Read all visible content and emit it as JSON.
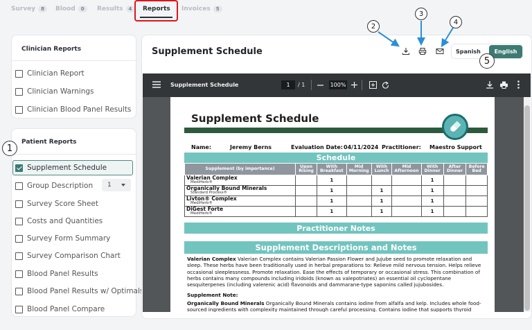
{
  "tabs": [
    {
      "label": "Survey",
      "count": "8"
    },
    {
      "label": "Blood",
      "count": "0"
    },
    {
      "label": "Results",
      "count": "4"
    },
    {
      "label": "Reports"
    },
    {
      "label": "Invoices",
      "count": "5"
    }
  ],
  "clinician": {
    "title": "Clinician Reports",
    "items": [
      "Clinician Report",
      "Clinician Warnings",
      "Clinician Blood Panel Results"
    ]
  },
  "patient": {
    "title": "Patient Reports",
    "items": [
      "Supplement Schedule",
      "Group Description",
      "Survey Score Sheet",
      "Costs and Quantities",
      "Survey Form Summary",
      "Survey Comparison Chart",
      "Blood Panel Results",
      "Blood Panel Results w/ Optimals",
      "Blood Panel Compare"
    ],
    "group_select_value": "1"
  },
  "callouts": [
    "1",
    "2",
    "3",
    "4",
    "5"
  ],
  "document": {
    "title": "Supplement Schedule",
    "lang_spanish": "Spanish",
    "lang_english": "English"
  },
  "viewer": {
    "filename": "Supplement Schedule",
    "page_current": "1",
    "page_total": "/ 1",
    "zoom": "100%"
  },
  "pdf": {
    "title": "Supplement Schedule",
    "name_label": "Name:",
    "name_value": "Jeremy Berns",
    "date_label": "Evaluation Date:",
    "date_value": "04/11/2024",
    "practitioner_label": "Practitioner:",
    "practitioner_value": "Maestro Support",
    "schedule_heading": "Schedule",
    "columns": [
      "Supplement (by importance)",
      "Upon Rising",
      "With Breakfast",
      "Mid Morning",
      "With Lunch",
      "Mid Afternoon",
      "With Dinner",
      "After Dinner",
      "Before Bed"
    ],
    "rows": [
      {
        "name": "Valerian Complex",
        "brand": "MediHerb®",
        "cells": [
          "",
          "1",
          "",
          "",
          "",
          "1",
          "",
          ""
        ]
      },
      {
        "name": "Organically Bound Minerals",
        "brand": "Standard Process®",
        "cells": [
          "",
          "1",
          "",
          "1",
          "",
          "1",
          "",
          ""
        ]
      },
      {
        "name": "Livton® Complex",
        "brand": "MediHerb®",
        "cells": [
          "",
          "1",
          "",
          "1",
          "",
          "1",
          "",
          ""
        ]
      },
      {
        "name": "DiGest Forte",
        "brand": "MediHerb®",
        "cells": [
          "",
          "1",
          "",
          "1",
          "",
          "1",
          "",
          ""
        ]
      }
    ],
    "practitioner_notes_heading": "Practitioner Notes",
    "descriptions_heading": "Supplement Descriptions and Notes",
    "desc1_name": "Valerian Complex",
    "desc1_text": "Valerian Complex contains Valerian Passion Flower and Jujube seed to promote relaxation and sleep. These herbs have been traditionally used in herbal preparations to: Relieve mild nervous tension. Helps relieve occasional sleeplessness. Promote relaxation. Ease the effects of temporary or occasional stress. This combination of herbs contains many compounds including iridoids (known as valepotriates) an essential oil cyclopentane sesquiterpenes (including valerenic acid) flavonoids and dammarane-type saponins called jujubosides.",
    "supplement_note_label": "Supplement Note:",
    "desc2_name": "Organically Bound Minerals",
    "desc2_text": "Organically Bound Minerals contains iodine from alfalfa and kelp. Includes whole food-sourced ingredients with complexity maintained through careful processing. Contains iodine that supports thyroid function/thyroid hormone"
  }
}
